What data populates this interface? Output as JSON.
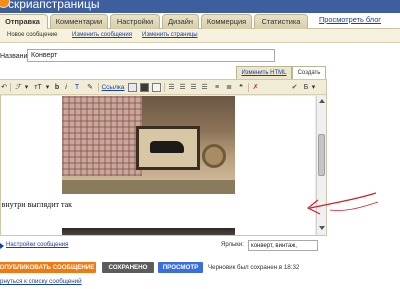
{
  "header": {
    "brand": "скриапстраницы"
  },
  "main_tabs": {
    "items": [
      {
        "label": "Отправка",
        "active": true
      },
      {
        "label": "Комментарии",
        "active": false
      },
      {
        "label": "Настройки",
        "active": false
      },
      {
        "label": "Дизайн",
        "active": false
      },
      {
        "label": "Коммерция",
        "active": false
      },
      {
        "label": "Статистика",
        "active": false
      }
    ],
    "view_blog": "Просмотреть блог"
  },
  "sub_tabs": [
    {
      "label": "Новое сообщение",
      "current": true
    },
    {
      "label": "Изменить сообщения",
      "current": false
    },
    {
      "label": "Изменить страницы",
      "current": false
    }
  ],
  "post": {
    "title_label": "Название:",
    "title_value": "Конверт",
    "mode_html": "Изменить HTML",
    "mode_compose": "Создать"
  },
  "toolbar": {
    "font_glyph": "ℱ",
    "size_glyph": "тT",
    "bold": "b",
    "italic": "i",
    "link_label": "Ссылка",
    "spell_glyph": "Б"
  },
  "content": {
    "caption": "а внутри выглядит так"
  },
  "settings": {
    "link_label": "Настройки сообщения",
    "labels_label": "Ярлыки:",
    "labels_value": "конверт, винтаж,"
  },
  "actions": {
    "publish": "ОПУБЛИКОВАТЬ СООБЩЕНИЕ",
    "saved": "СОХРАНЕНО",
    "preview": "ПРОСМОТР",
    "draft_status": "Черновик был сохранен в 18:32",
    "back_link": "рнуться к списку сообщений"
  },
  "colors": {
    "header_blue": "#3d5f9e",
    "tab_beige": "#e9e3c9",
    "publish_orange": "#f07a12",
    "saved_gray": "#5c5c5c",
    "preview_blue": "#3b6fdc",
    "annotation_red": "#d1202a",
    "link_blue": "#1a3fa8"
  },
  "icons": [
    "logo-icon",
    "undo-icon",
    "font-icon",
    "size-icon",
    "text-color-icon",
    "highlight-icon",
    "link-icon",
    "image-icon",
    "video-icon",
    "jump-break-icon",
    "align-left-icon",
    "align-center-icon",
    "align-right-icon",
    "justify-icon",
    "numbered-list-icon",
    "bullet-list-icon",
    "quote-icon",
    "clear-format-icon",
    "spellcheck-icon"
  ]
}
